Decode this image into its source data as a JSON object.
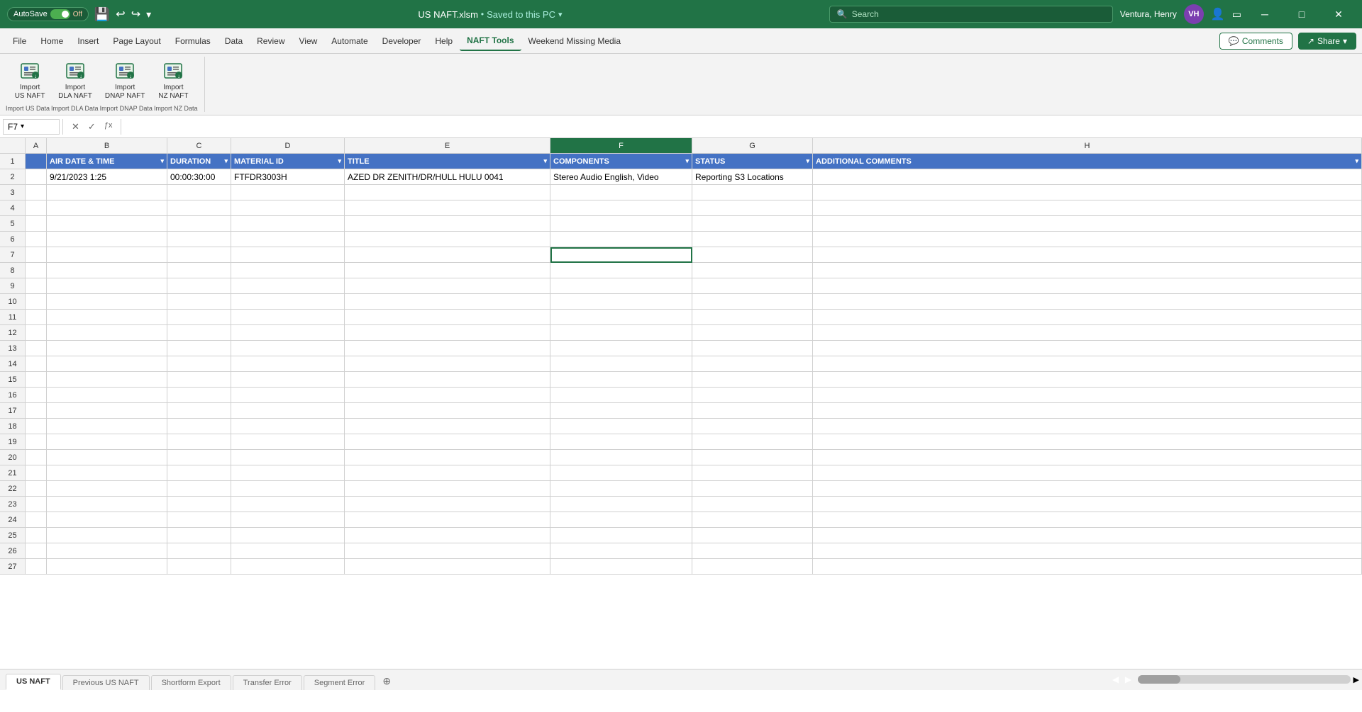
{
  "titlebar": {
    "autosave_label": "AutoSave",
    "autosave_state": "Off",
    "filename": "US NAFT.xlsm",
    "saved_label": "Saved to this PC",
    "search_placeholder": "Search",
    "user_name": "Ventura, Henry",
    "user_initials": "VH",
    "minimize": "─",
    "maximize": "□",
    "close": "✕"
  },
  "menubar": {
    "items": [
      "File",
      "Home",
      "Insert",
      "Page Layout",
      "Formulas",
      "Data",
      "Review",
      "View",
      "Automate",
      "Developer",
      "Help",
      "NAFT Tools",
      "Weekend Missing Media"
    ],
    "active_item": "NAFT Tools",
    "comments_label": "Comments",
    "share_label": "Share"
  },
  "ribbon": {
    "buttons": [
      {
        "label": "Import\nUS NAFT",
        "name": "import-us-naft"
      },
      {
        "label": "Import\nDLA NAFT",
        "name": "import-dla-naft"
      },
      {
        "label": "Import\nDNAP NAFT",
        "name": "import-dnap-naft"
      },
      {
        "label": "Import\nNZ NAFT",
        "name": "import-nz-naft"
      }
    ],
    "sublabels": [
      "Import US Data",
      "Import DLA Data",
      "Import DNAP Data",
      "Import NZ Data"
    ]
  },
  "formula_bar": {
    "cell_ref": "F7",
    "formula": ""
  },
  "columns": {
    "widths": [
      36,
      30,
      170,
      90,
      160,
      290,
      200,
      150,
      350
    ],
    "headers": [
      "",
      "A",
      "B",
      "C",
      "D",
      "E",
      "F",
      "G",
      "H"
    ],
    "selected": "F"
  },
  "table_headers": {
    "row": 1,
    "cells": [
      {
        "col": "B",
        "label": "AIR DATE & TIME"
      },
      {
        "col": "C",
        "label": "DURATION"
      },
      {
        "col": "D",
        "label": "MATERIAL ID"
      },
      {
        "col": "E",
        "label": "TITLE"
      },
      {
        "col": "F",
        "label": "COMPONENTS"
      },
      {
        "col": "G",
        "label": "STATUS"
      },
      {
        "col": "H",
        "label": "ADDITIONAL COMMENTS"
      }
    ]
  },
  "data_rows": [
    {
      "row": 2,
      "B": "9/21/2023 1:25",
      "C": "00:00:30:00",
      "D": "FTFDR3003H",
      "E": "AZED DR ZENITH/DR/HULL HULU 0041",
      "F": "Stereo Audio English, Video",
      "G": "Reporting S3 Locations",
      "H": ""
    }
  ],
  "empty_rows": [
    3,
    4,
    5,
    6,
    7,
    8,
    9,
    10,
    11,
    12,
    13,
    14,
    15,
    16,
    17,
    18,
    19,
    20,
    21,
    22,
    23,
    24,
    25,
    26,
    27
  ],
  "selected_cell": {
    "row": 7,
    "col": "F"
  },
  "sheet_tabs": [
    {
      "label": "US NAFT",
      "active": true
    },
    {
      "label": "Previous US NAFT",
      "active": false
    },
    {
      "label": "Shortform Export",
      "active": false
    },
    {
      "label": "Transfer Error",
      "active": false
    },
    {
      "label": "Segment Error",
      "active": false
    }
  ],
  "add_sheet_label": "+",
  "colors": {
    "excel_green": "#217346",
    "header_blue": "#4472c4",
    "row_bg": "#ffffff",
    "alt_row_bg": "#f9f9f9"
  }
}
